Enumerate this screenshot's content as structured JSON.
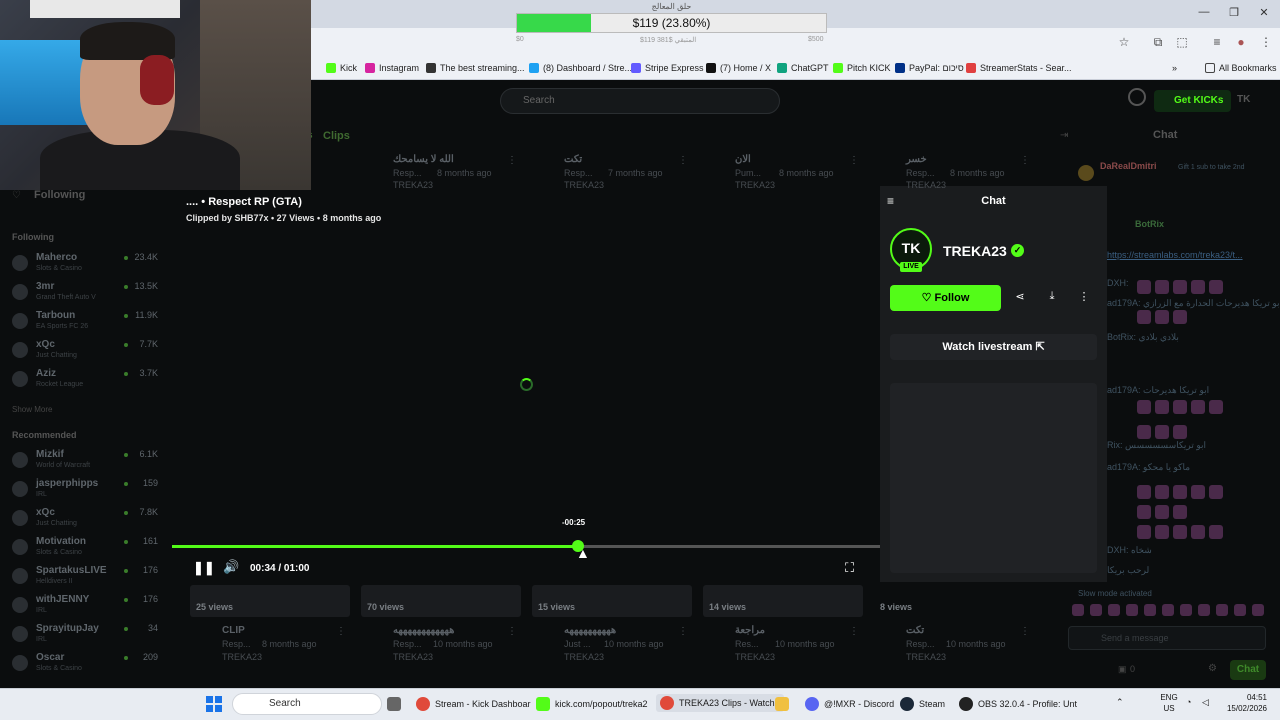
{
  "donation_goal": {
    "title": "حلق المعالج",
    "amount_text": "$119 (23.80%)",
    "progress_fraction": 0.238,
    "start_label": "$0",
    "mid_label": "$119 المتبقي $381",
    "end_label": "$500"
  },
  "bookmarks": [
    {
      "label": "Kick",
      "color": "#53fc18"
    },
    {
      "label": "Instagram",
      "color": "#d6249f"
    },
    {
      "label": "The best streaming...",
      "color": "#333333"
    },
    {
      "label": "(8) Dashboard / Stre...",
      "color": "#1da1f2"
    },
    {
      "label": "Stripe Express",
      "color": "#635bff"
    },
    {
      "label": "(7) Home / X",
      "color": "#111111"
    },
    {
      "label": "ChatGPT",
      "color": "#10a37f"
    },
    {
      "label": "Pitch KICK",
      "color": "#53fc18"
    },
    {
      "label": "PayPal: סיכום",
      "color": "#003087"
    },
    {
      "label": "StreamerStats - Sear...",
      "color": "#e04040"
    }
  ],
  "all_bookmarks": "All Bookmarks",
  "kick": {
    "search_placeholder": "Search",
    "get_kicks": "Get KICKs",
    "tab_clips": "Clips",
    "following_header": "Following",
    "following_section": "Following",
    "show_more": "Show More",
    "recommended": "Recommended",
    "chat_header": "Chat",
    "following": [
      {
        "name": "Maherco",
        "cat": "Slots & Casino",
        "count": "23.4K"
      },
      {
        "name": "3mr",
        "cat": "Grand Theft Auto V",
        "count": "13.5K"
      },
      {
        "name": "Tarboun",
        "cat": "EA Sports FC 26",
        "count": "11.9K"
      },
      {
        "name": "xQc",
        "cat": "Just Chatting",
        "count": "7.7K"
      },
      {
        "name": "Aziz",
        "cat": "Rocket League",
        "count": "3.7K"
      }
    ],
    "recommended_list": [
      {
        "name": "Mizkif",
        "cat": "World of Warcraft",
        "count": "6.1K"
      },
      {
        "name": "jasperphipps",
        "cat": "IRL",
        "count": "159"
      },
      {
        "name": "xQc",
        "cat": "Just Chatting",
        "count": "7.8K"
      },
      {
        "name": "Motivation",
        "cat": "Slots & Casino",
        "count": "161"
      },
      {
        "name": "SpartakusLIVE",
        "cat": "Helldivers II",
        "count": "176"
      },
      {
        "name": "withJENNY",
        "cat": "IRL",
        "count": "176"
      },
      {
        "name": "SprayitupJay",
        "cat": "IRL",
        "count": "34"
      },
      {
        "name": "Oscar",
        "cat": "Slots & Casino",
        "count": "209"
      }
    ],
    "top_clips": [
      {
        "title": "الله لا يسامحك",
        "meta": "Resp...",
        "ago": "8 months ago",
        "ch": "TREKA23"
      },
      {
        "title": "تكت",
        "meta": "Resp...",
        "ago": "7 months ago",
        "ch": "TREKA23"
      },
      {
        "title": "الان",
        "meta": "Pum...",
        "ago": "8 months ago",
        "ch": "TREKA23"
      },
      {
        "title": "خسر",
        "meta": "Resp...",
        "ago": "8 months ago",
        "ch": "TREKA23"
      }
    ],
    "bottom_clips": [
      {
        "views": "25 views",
        "title": "CLIP",
        "meta": "Resp...",
        "ago": "8 months ago",
        "ch": "TREKA23"
      },
      {
        "views": "70 views",
        "title": "ههههههههههههه",
        "meta": "Resp...",
        "ago": "10 months ago",
        "ch": "TREKA23"
      },
      {
        "views": "15 views",
        "title": "ههههههههههه",
        "meta": "Just ...",
        "ago": "10 months ago",
        "ch": "TREKA23"
      },
      {
        "views": "14 views",
        "title": "مراجعة",
        "meta": "Res...",
        "ago": "10 months ago",
        "ch": "TREKA23"
      },
      {
        "views": "8 views",
        "title": "تكت",
        "meta": "Resp...",
        "ago": "10 months ago",
        "ch": "TREKA23"
      }
    ],
    "chat_lines": [
      "DaRealDmitri",
      "Gift 1 sub to take 2nd",
      "BotRix",
      "https://streamlabs.com/treka23/t...",
      "DXH:",
      "ad179A: ابو تريكا هديرحات الحدارة مع الزرازي",
      "BotRix: بلادي بلادي",
      "ad179A: ابو تريكا هديرحات",
      "ad179A:",
      "Rix: ابو تريكاسسسسسس",
      "ad179A: ماكو يا محكو",
      "DXH: شخاه",
      "لرحب بريكا"
    ],
    "slow_mode": "Slow mode activated",
    "send_placeholder": "Send a message",
    "chat_button": "Chat",
    "points": "0"
  },
  "clip_modal": {
    "title": ".... • Respect RP (GTA)",
    "subtitle": "Clipped by SHB77x • 27 Views • 8 months ago",
    "hover_time": "-00:25",
    "time_display": "00:34 / 01:00",
    "progress_fraction": 0.567,
    "panel_title": "Chat",
    "channel": "TREKA23",
    "avatar_text": "TK",
    "live_label": "LIVE",
    "follow_label": "Follow",
    "watch_label": "Watch livestream"
  },
  "taskbar": {
    "search": "Search",
    "items": [
      "Stream - Kick Dashboar",
      "kick.com/popout/treka2",
      "TREKA23 Clips - Watch I",
      "@!MXR - Discord",
      "Steam",
      "OBS 32.0.4 - Profile: Unt"
    ],
    "lang_top": "ENG",
    "lang_bottom": "US",
    "time": "04:51",
    "date": "15/02/2026"
  }
}
